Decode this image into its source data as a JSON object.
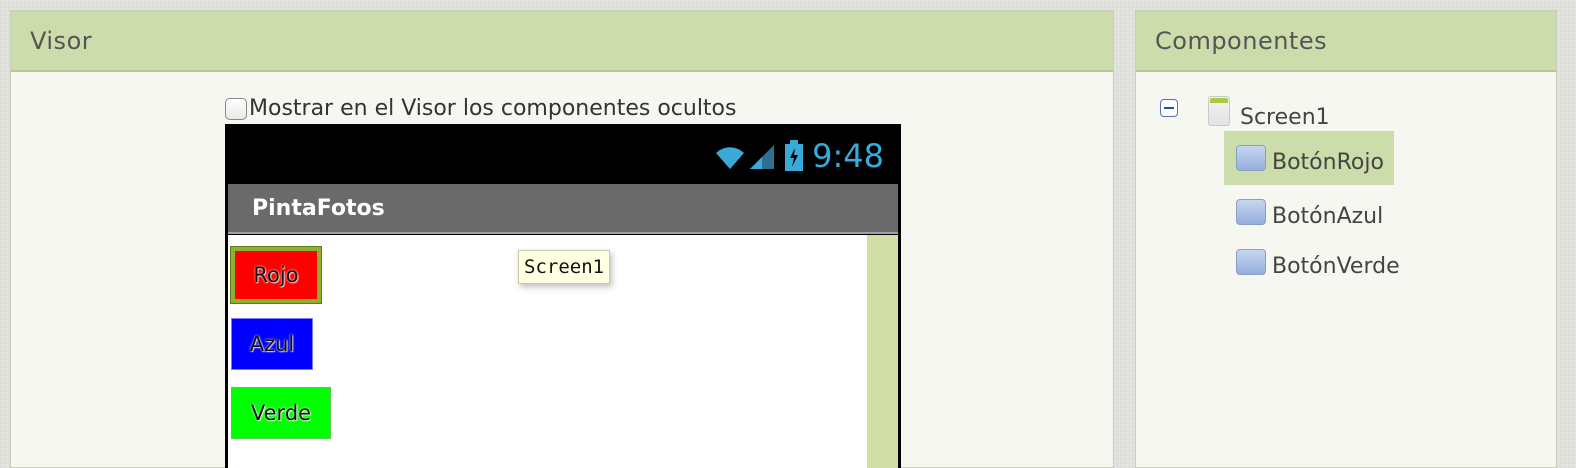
{
  "visor": {
    "title": "Visor",
    "show_hidden_label": "Mostrar en el Visor los componentes ocultos",
    "phone": {
      "time": "9:48",
      "app_title": "PintaFotos",
      "buttons": [
        {
          "label": "Rojo",
          "color": "#ff0000"
        },
        {
          "label": "Azul",
          "color": "#0000ff"
        },
        {
          "label": "Verde",
          "color": "#00ff00"
        }
      ],
      "tooltip": "Screen1"
    }
  },
  "components": {
    "title": "Componentes",
    "root": "Screen1",
    "children": [
      "BotónRojo",
      "BotónAzul",
      "BotónVerde"
    ],
    "selected": "BotónRojo"
  },
  "colors": {
    "header_bg": "#cddcab",
    "selection": "#cddcab",
    "status_icon": "#3aa9d8"
  },
  "icons": [
    "collapse-icon",
    "screen-icon",
    "button-icon",
    "wifi-icon",
    "signal-icon",
    "battery-icon"
  ]
}
